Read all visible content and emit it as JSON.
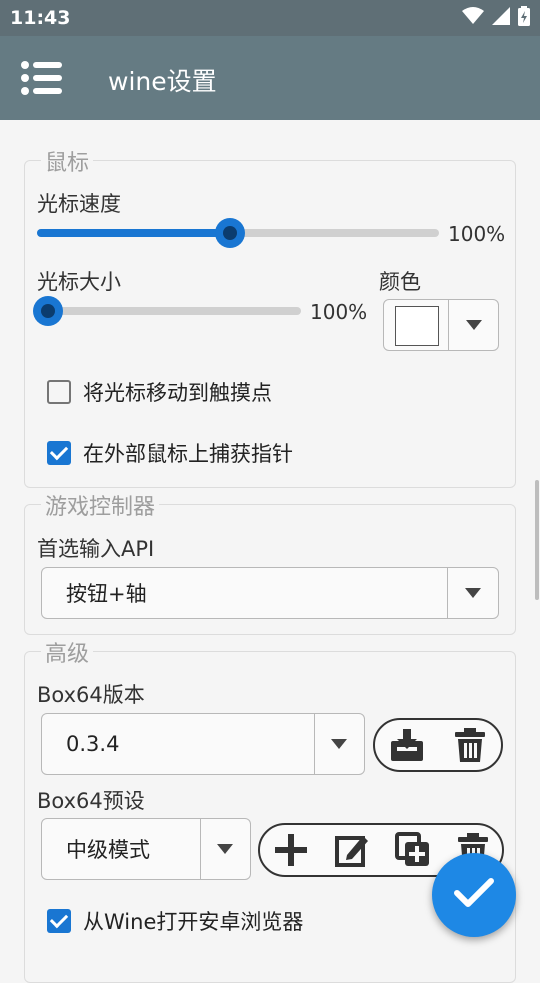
{
  "status": {
    "time": "11:43"
  },
  "appbar": {
    "title": "wine设置"
  },
  "mouse": {
    "legend": "鼠标",
    "cursor_speed": {
      "label": "光标速度",
      "value_text": "100%",
      "fraction": 0.48
    },
    "cursor_size": {
      "label": "光标大小",
      "value_text": "100%",
      "fraction": 0.0
    },
    "color": {
      "label": "颜色",
      "selected": "#ffffff"
    },
    "move_cursor_to_touch": {
      "label": "将光标移动到触摸点",
      "checked": false
    },
    "capture_pointer": {
      "label": "在外部鼠标上捕获指针",
      "checked": true
    }
  },
  "gamepad": {
    "legend": "游戏控制器",
    "preferred_api": {
      "label": "首选输入API",
      "value": "按钮+轴"
    }
  },
  "advanced": {
    "legend": "高级",
    "box64_version": {
      "label": "Box64版本",
      "value": "0.3.4"
    },
    "box64_preset": {
      "label": "Box64预设",
      "value": "中级模式"
    },
    "open_android_browser": {
      "label": "从Wine打开安卓浏览器",
      "checked": true
    }
  },
  "colors": {
    "accent": "#1976d2",
    "appbar": "#657b83",
    "statusbar": "#5f6f76",
    "fab": "#1e88e5"
  },
  "icons": [
    "wifi-icon",
    "signal-icon",
    "battery-icon",
    "menu-icon",
    "download-icon",
    "trash-icon",
    "add-icon",
    "edit-icon",
    "copy-add-icon",
    "check-icon",
    "chevron-down-icon"
  ]
}
